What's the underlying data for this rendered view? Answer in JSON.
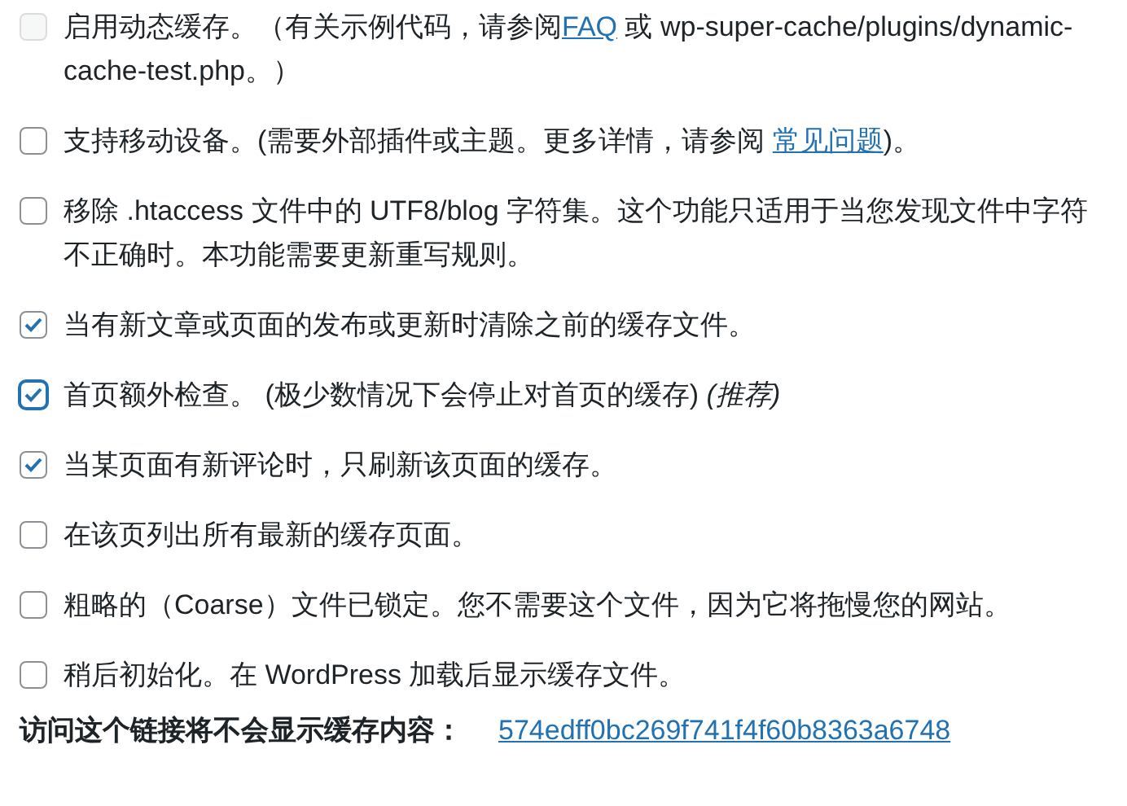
{
  "options": [
    {
      "checked": false,
      "disabled": true,
      "focused": false,
      "parts": [
        {
          "kind": "text",
          "text": "启用动态缓存。（有关示例代码，请参阅"
        },
        {
          "kind": "link",
          "text": "FAQ"
        },
        {
          "kind": "text",
          "text": " 或 wp-super-cache/plugins/dynamic-cache-test.php。）"
        }
      ]
    },
    {
      "checked": false,
      "disabled": false,
      "focused": false,
      "parts": [
        {
          "kind": "text",
          "text": "支持移动设备。(需要外部插件或主题。更多详情，请参阅 "
        },
        {
          "kind": "link",
          "text": "常见问题"
        },
        {
          "kind": "text",
          "text": ")。"
        }
      ]
    },
    {
      "checked": false,
      "disabled": false,
      "focused": false,
      "parts": [
        {
          "kind": "text",
          "text": "移除 .htaccess 文件中的 UTF8/blog 字符集。这个功能只适用于当您发现文件中字符不正确时。本功能需要更新重写规则。"
        }
      ]
    },
    {
      "checked": true,
      "disabled": false,
      "focused": false,
      "parts": [
        {
          "kind": "text",
          "text": "当有新文章或页面的发布或更新时清除之前的缓存文件。"
        }
      ]
    },
    {
      "checked": true,
      "disabled": false,
      "focused": true,
      "parts": [
        {
          "kind": "text",
          "text": "首页额外检查。 (极少数情况下会停止对首页的缓存) "
        },
        {
          "kind": "italic",
          "text": "(推荐)"
        }
      ]
    },
    {
      "checked": true,
      "disabled": false,
      "focused": false,
      "parts": [
        {
          "kind": "text",
          "text": "当某页面有新评论时，只刷新该页面的缓存。"
        }
      ]
    },
    {
      "checked": false,
      "disabled": false,
      "focused": false,
      "parts": [
        {
          "kind": "text",
          "text": "在该页列出所有最新的缓存页面。"
        }
      ]
    },
    {
      "checked": false,
      "disabled": false,
      "focused": false,
      "parts": [
        {
          "kind": "text",
          "text": "粗略的（Coarse）文件已锁定。您不需要这个文件，因为它将拖慢您的网站。"
        }
      ]
    },
    {
      "checked": false,
      "disabled": false,
      "focused": false,
      "parts": [
        {
          "kind": "text",
          "text": "稍后初始化。在 WordPress 加载后显示缓存文件。"
        }
      ]
    }
  ],
  "footer": {
    "label": "访问这个链接将不会显示缓存内容：",
    "link": "574edff0bc269f741f4f60b8363a6748"
  }
}
